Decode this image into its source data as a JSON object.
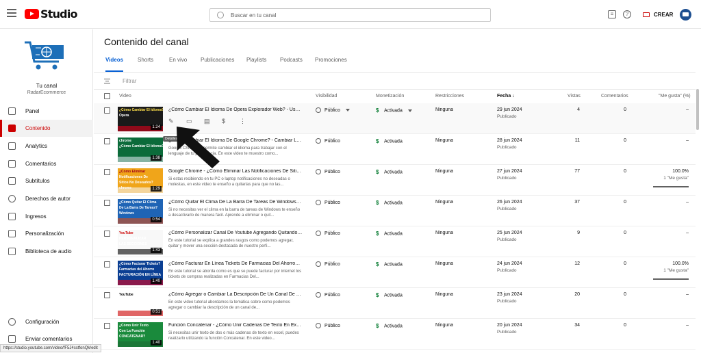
{
  "app": {
    "logo_text": "Studio"
  },
  "search": {
    "placeholder": "Buscar en tu canal"
  },
  "header": {
    "create_label": "CREAR"
  },
  "sidebar": {
    "channel_name": "Tu canal",
    "channel_handle": "RadarEcommerce",
    "items": [
      {
        "label": "Panel",
        "icon": "dashboard-icon"
      },
      {
        "label": "Contenido",
        "icon": "content-icon"
      },
      {
        "label": "Analytics",
        "icon": "analytics-icon"
      },
      {
        "label": "Comentarios",
        "icon": "comments-icon"
      },
      {
        "label": "Subtítulos",
        "icon": "subtitles-icon"
      },
      {
        "label": "Derechos de autor",
        "icon": "copyright-icon"
      },
      {
        "label": "Ingresos",
        "icon": "earn-icon"
      },
      {
        "label": "Personalización",
        "icon": "customization-icon"
      },
      {
        "label": "Biblioteca de audio",
        "icon": "audio-library-icon"
      }
    ],
    "bottom_items": [
      {
        "label": "Configuración",
        "icon": "settings-icon"
      },
      {
        "label": "Enviar comentarios",
        "icon": "feedback-icon"
      }
    ]
  },
  "status_bar": {
    "url": "https://studio.youtube.com/video/fF5J4sstfonQk/edit"
  },
  "main": {
    "title": "Contenido del canal",
    "tabs": [
      "Videos",
      "Shorts",
      "En vivo",
      "Publicaciones",
      "Playlists",
      "Podcasts",
      "Promociones"
    ],
    "filter_placeholder": "Filtrar",
    "columns": {
      "video": "Video",
      "visibility": "Visibilidad",
      "monetization": "Monetización",
      "restrictions": "Restricciones",
      "date": "Fecha",
      "views": "Vistas",
      "comments": "Comentarios",
      "likes": "\"Me gusta\" (%)"
    },
    "tooltip": "Detalles",
    "rows": [
      {
        "thumb": [
          "¿Cómo Cambiar El Idioma?",
          "Opera"
        ],
        "duration": "1:24",
        "title": "¿Cómo Cambiar El Idioma De Opera Explorador Web? - Usar ...",
        "desc": "",
        "visibility": "Público",
        "monetization": "Activada",
        "restrictions": "Ninguna",
        "date": "29 jun 2024",
        "status": "Publicado",
        "views": "4",
        "comments": "0",
        "likes": "–",
        "likes_count": ""
      },
      {
        "thumb": [
          "chrome",
          "¿Cómo Cambiar El Idioma?"
        ],
        "duration": "1:38",
        "title": "¿Cómo Cambiar El Idioma De Google Chrome? - Cambiar Len...",
        "desc": "Google Chrome te permite cambiar el idioma para trabajar con el lenguaje de tu preferencia. En este video te muestro como...",
        "visibility": "Público",
        "monetization": "Activada",
        "restrictions": "Ninguna",
        "date": "28 jun 2024",
        "status": "Publicado",
        "views": "11",
        "comments": "0",
        "likes": "–",
        "likes_count": ""
      },
      {
        "thumb": [
          "¿Cómo Eliminar",
          "Notificaciones De",
          "Sitios No Deseados?",
          "chrome"
        ],
        "duration": "1:29",
        "title": "Google Chrome - ¿Cómo Eliminar Las Notificaciones De Sitio...",
        "desc": "Si estas recibiendo en tu PC o laptop notificaciones no deseadas o molestas, en este video te enseño a quitarlas para que no las...",
        "visibility": "Público",
        "monetization": "Activada",
        "restrictions": "Ninguna",
        "date": "27 jun 2024",
        "status": "Publicado",
        "views": "77",
        "comments": "0",
        "likes": "100.0%",
        "likes_count": "1 \"Me gusta\"",
        "likes_fill": 1.0
      },
      {
        "thumb": [
          "¿Cómo Quitar El Clima",
          "De La Barra De Tareas?",
          "Windows"
        ],
        "duration": "0:54",
        "title": "¿Cómo Quitar El Clima De La Barra De Tareas De Windows? - ...",
        "desc": "Si no necesitas ver el clima en la barra de tareas de Windows te enseño a desactivarlo de manera fácil. Aprende a eliminar o quit...",
        "visibility": "Público",
        "monetization": "Activada",
        "restrictions": "Ninguna",
        "date": "26 jun 2024",
        "status": "Publicado",
        "views": "37",
        "comments": "0",
        "likes": "–",
        "likes_count": ""
      },
      {
        "thumb": [
          "YouTube",
          "PERSONALIZAR",
          "LAS SECCIONES"
        ],
        "duration": "1:43",
        "title": "¿Cómo Personalizar Canal De Youtube Agregando Quitando ...",
        "desc": "En este tutorial se explica a grandes rasgos como podemos agregar, quitar y mover una sección destacada de nuestro perfi...",
        "visibility": "Público",
        "monetization": "Activada",
        "restrictions": "Ninguna",
        "date": "25 jun 2024",
        "status": "Publicado",
        "views": "9",
        "comments": "0",
        "likes": "–",
        "likes_count": ""
      },
      {
        "thumb": [
          "¿Cómo Facturar Tickets?",
          "Farmacias del Ahorro",
          "FACTURACIÓN EN LÍNEA"
        ],
        "duration": "1:40",
        "title": "¿Cómo Facturar En Línea Tickets De Farmacias Del Ahorro? - ...",
        "desc": "En este tutorial se aborda como es que se puede facturar por internet los tickets de compras realizadas en Farmacias Del...",
        "visibility": "Público",
        "monetization": "Activada",
        "restrictions": "Ninguna",
        "date": "24 jun 2024",
        "status": "Publicado",
        "views": "12",
        "comments": "0",
        "likes": "100.0%",
        "likes_count": "1 \"Me gusta\"",
        "likes_fill": 1.0
      },
      {
        "thumb": [
          "YouTube",
          "¿CÓMO AGREGAR LA",
          "DESCRIPCIÓN DE UN",
          "CANAL?"
        ],
        "duration": "0:51",
        "title": "¿Cómo Agregar o Cambiar La Descripción De Un Canal De Yo...",
        "desc": "En este video tutorial abordamos la temática sobre como podemos agregar o cambiar la descripción de un canal de...",
        "visibility": "Público",
        "monetization": "Activada",
        "restrictions": "Ninguna",
        "date": "23 jun 2024",
        "status": "Publicado",
        "views": "20",
        "comments": "0",
        "likes": "–",
        "likes_count": ""
      },
      {
        "thumb": [
          "¿Cómo Unir Texto",
          "Con La Función",
          "CONCATENAR?"
        ],
        "duration": "1:40",
        "title": "Función Concatenar - ¿Cómo Unir Cadenas De Texto En Excel...",
        "desc": "Si necesitas unir texto de dos o más cadenas de texto en excel, puedes realizarlo utilizando la función Concatenar. En este video...",
        "visibility": "Público",
        "monetization": "Activada",
        "restrictions": "Ninguna",
        "date": "20 jun 2024",
        "status": "Publicado",
        "views": "34",
        "comments": "0",
        "likes": "–",
        "likes_count": ""
      }
    ]
  },
  "colors": {
    "accent": "#065fd4",
    "brand": "#ff0000",
    "active_nav": "#cc0000",
    "monetization": "#0a7d33"
  }
}
